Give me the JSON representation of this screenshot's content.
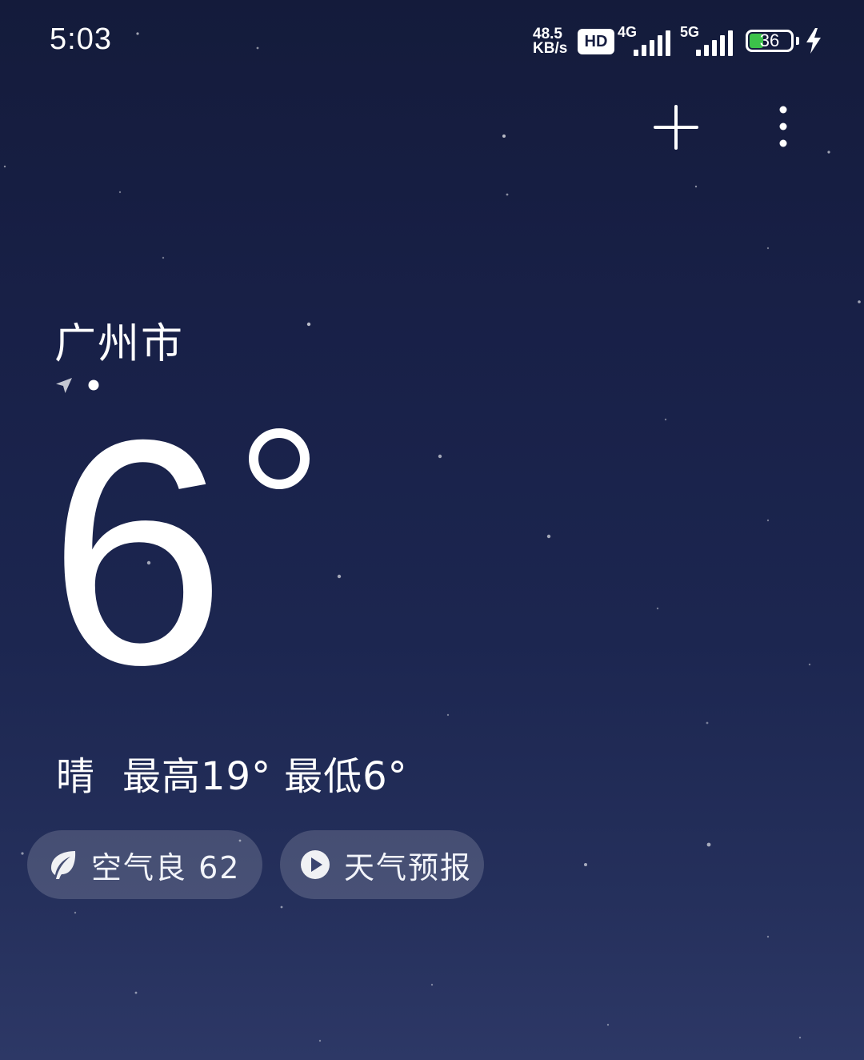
{
  "status_bar": {
    "time": "5:03",
    "net_speed_value": "48.5",
    "net_speed_unit": "KB/s",
    "hd_label": "HD",
    "sig1_label": "4G",
    "sig2_label": "5G",
    "battery_level": "36",
    "battery_fraction": 0.36
  },
  "toolbar": {
    "add_icon": "plus-icon",
    "more_icon": "more-vertical-icon"
  },
  "weather": {
    "city": "广州市",
    "temperature": "6",
    "condition": "晴",
    "high": "最高19°",
    "low": "最低6°"
  },
  "pills": {
    "aqi_label": "空气良 62",
    "aqi_icon": "leaf-icon",
    "video_label": "天气预报",
    "video_icon": "play-icon"
  },
  "colors": {
    "background_top": "#141b3b",
    "background_bottom": "#2d3866",
    "battery_green": "#3cc24a",
    "pill_background": "rgba(255,255,255,0.16)"
  }
}
